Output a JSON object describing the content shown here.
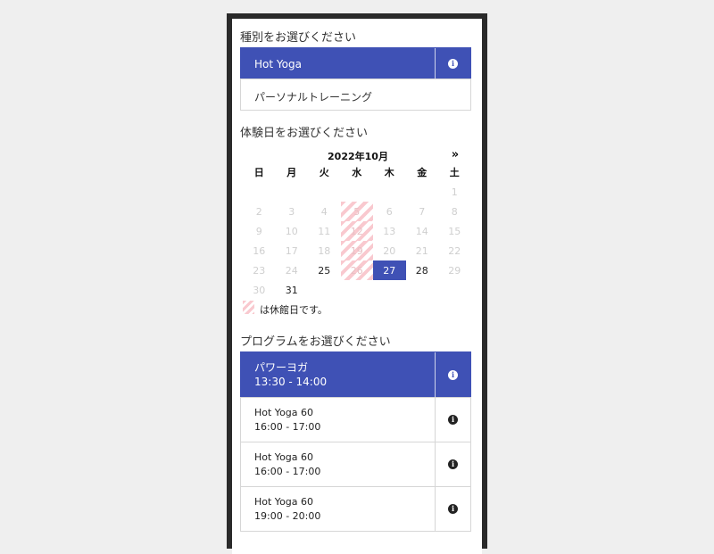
{
  "type_section": {
    "label": "種別をお選びください",
    "options": [
      {
        "label": "Hot Yoga",
        "selected": true,
        "icon": "info-icon"
      },
      {
        "label": "パーソナルトレーニング",
        "selected": false
      }
    ]
  },
  "date_section": {
    "label": "体験日をお選びください",
    "month_title": "2022年10月",
    "next_label": "»",
    "weekdays": [
      "日",
      "月",
      "火",
      "水",
      "木",
      "金",
      "土"
    ],
    "days": [
      [
        "",
        "",
        "",
        "",
        "",
        "",
        "1"
      ],
      [
        "2",
        "3",
        "4",
        "5",
        "6",
        "7",
        "8"
      ],
      [
        "9",
        "10",
        "11",
        "12",
        "13",
        "14",
        "15"
      ],
      [
        "16",
        "17",
        "18",
        "19",
        "20",
        "21",
        "22"
      ],
      [
        "23",
        "24",
        "25",
        "26",
        "27",
        "28",
        "29"
      ],
      [
        "30",
        "31",
        "",
        "",
        "",
        "",
        ""
      ]
    ],
    "available_days": [
      "25",
      "27",
      "28",
      "31"
    ],
    "selected_day": "27",
    "holidays": [
      "5",
      "12",
      "19",
      "26"
    ],
    "legend_text": "は休館日です。"
  },
  "program_section": {
    "label": "プログラムをお選びください",
    "programs": [
      {
        "name": "パワーヨガ",
        "time": "13:30 - 14:00",
        "selected": true
      },
      {
        "name": "Hot Yoga 60",
        "time": "16:00 - 17:00",
        "selected": false
      },
      {
        "name": "Hot Yoga 60",
        "time": "16:00 - 17:00",
        "selected": false
      },
      {
        "name": "Hot Yoga 60",
        "time": "19:00 - 20:00",
        "selected": false
      }
    ]
  },
  "colors": {
    "accent": "#3f51b5",
    "holiday_stripe": "#f9c9cf",
    "background": "#efefef"
  }
}
